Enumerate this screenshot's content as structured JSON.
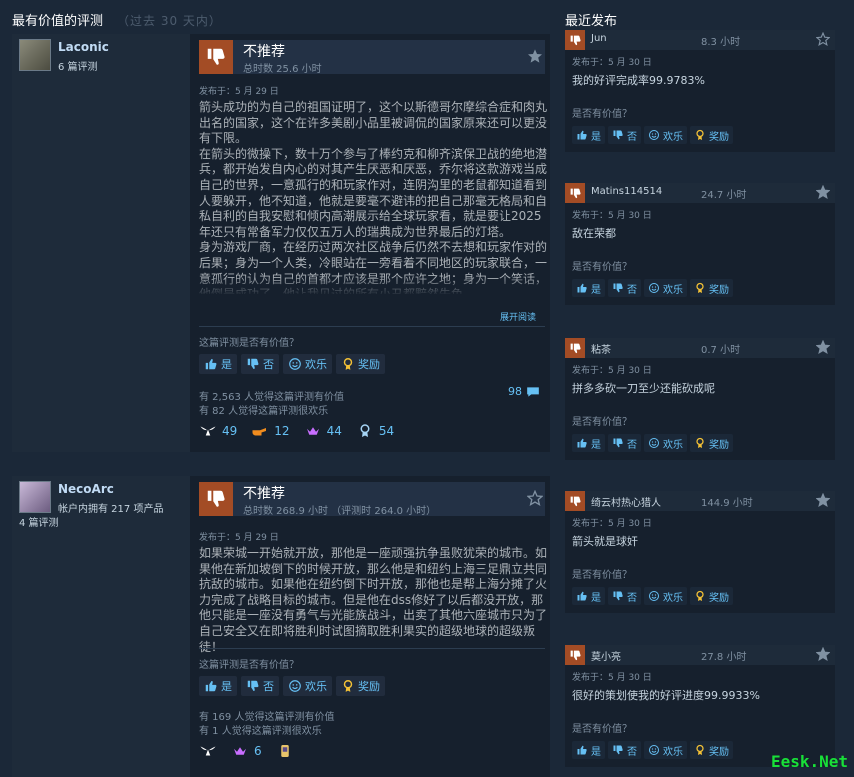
{
  "left_title": "最有价值的评测",
  "left_subtitle": "（过去 30 天内）",
  "right_title": "最近发布",
  "colors": {
    "background": "#1b2838",
    "negative_thumb": "#a34c25",
    "link": "#66c0f4"
  },
  "reviews": [
    {
      "author": "Laconic",
      "author_meta": "6 篇评测",
      "verdict": "不推荐",
      "hours": "总时数 25.6 小时",
      "post_date": "发布于：5 月 29 日",
      "body": "箭头成功的为自己的祖国证明了，这个以斯德哥尔摩综合症和肉丸出名的国家，这个在许多美剧小品里被调侃的国家原来还可以更没有下限。\n在箭头的微操下，数十万个参与了棒约克和柳齐滨保卫战的绝地潜兵，都开始发自内心的对其产生厌恶和厌恶，乔尔将这款游戏当成自己的世界，一意孤行的和玩家作对，连阴沟里的老鼠都知道看到人要躲开，他不知道，他就是要毫不避讳的把自己那毫无格局和自私自利的自我安慰和倾内高潮展示给全球玩家看，就是要让2025年还只有常备军力仅仅五万人的瑞典成为世界最后的灯塔。\n身为游戏厂商，在经历过两次社区战争后仍然不去想和玩家作对的后果；身为一个人类，冷眼站在一旁看着不同地区的玩家联合，一意孤行的认为自己的首都才应该是那个应许之地；身为一个笑话，他倒是成功了，他让我见过的所有小丑都黯然失色。",
      "expand": "展开阅读",
      "helpful_q": "这篇评测是否有价值？",
      "buttons": {
        "yes": "是",
        "no": "否",
        "funny": "欢乐",
        "award": "奖励"
      },
      "stat1": "有 2,563 人觉得这篇评测有价值",
      "stat2": "有 82 人觉得这篇评测很欢乐",
      "comments": "98",
      "awards": [
        "49",
        "12",
        "44",
        "54"
      ]
    },
    {
      "author": "NecoArc",
      "author_meta": "帐户内拥有 217 项产品",
      "author_meta2": "4 篇评测",
      "verdict": "不推荐",
      "hours": "总时数 268.9 小时 （评测时 264.0 小时）",
      "post_date": "发布于：5 月 29 日",
      "body": "如果荣城一开始就开放，那他是一座顽强抗争虽败犹荣的城市。如果他在新加坡倒下的时候开放，那么他是和纽约上海三足鼎立共同抗敌的城市。如果他在纽约倒下时开放，那他也是帮上海分摊了火力完成了战略目标的城市。但是他在dss修好了以后都没开放，那他只能是一座没有勇气与光能族战斗，出卖了其他六座城市只为了自己安全又在即将胜利时试图摘取胜利果实的超级地球的超级叛徒！",
      "helpful_q": "这篇评测是否有价值？",
      "buttons": {
        "yes": "是",
        "no": "否",
        "funny": "欢乐",
        "award": "奖励"
      },
      "stat1": "有 169 人觉得这篇评测有价值",
      "stat2": "有 1 人觉得这篇评测很欢乐",
      "awards": [
        "",
        "6",
        ""
      ]
    }
  ],
  "recent": [
    {
      "name": "Jun",
      "hours": "8.3 小时",
      "date": "发布于：5 月 30 日",
      "text": "我的好评完成率99.9783%",
      "q": "是否有价值？",
      "starred": false
    },
    {
      "name": "Matins114514",
      "hours": "24.7 小时",
      "date": "发布于：5 月 30 日",
      "text": "敌在荣都",
      "q": "是否有价值？",
      "starred": true
    },
    {
      "name": "粘茶",
      "hours": "0.7 小时",
      "date": "发布于：5 月 30 日",
      "text": "拼多多砍一刀至少还能砍成呢",
      "q": "是否有价值？",
      "starred": true
    },
    {
      "name": "绮云村热心猎人",
      "hours": "144.9 小时",
      "date": "发布于：5 月 30 日",
      "text": "箭头就是球奸",
      "q": "是否有价值？",
      "starred": true
    },
    {
      "name": "莫小亮",
      "hours": "27.8 小时",
      "date": "发布于：5 月 30 日",
      "text": "很好的策划使我的好评进度99.9933%",
      "q": "是否有价值？",
      "starred": true
    }
  ],
  "mini_buttons": {
    "yes": "是",
    "no": "否",
    "funny": "欢乐",
    "award": "奖励"
  },
  "watermark": "Eesk.Net"
}
